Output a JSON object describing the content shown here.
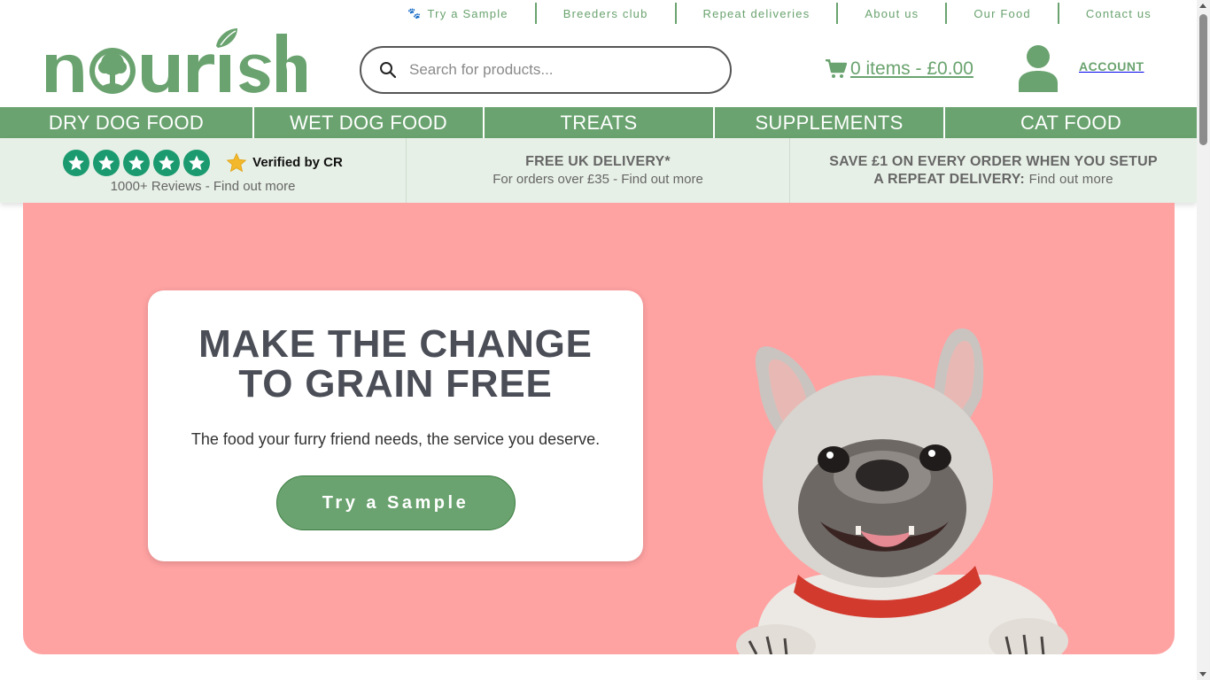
{
  "utility_nav": [
    {
      "label": "Try a Sample",
      "icon": "paw-icon"
    },
    {
      "label": "Breeders club"
    },
    {
      "label": "Repeat deliveries"
    },
    {
      "label": "About us"
    },
    {
      "label": "Our Food"
    },
    {
      "label": "Contact us"
    }
  ],
  "brand": {
    "logo_text": "nourish",
    "color": "#6aa36f"
  },
  "search": {
    "placeholder": "Search for products..."
  },
  "cart": {
    "summary": "0 items - £0.00"
  },
  "account": {
    "label": "ACCOUNT"
  },
  "categories": [
    {
      "label": "DRY DOG FOOD"
    },
    {
      "label": "WET DOG FOOD"
    },
    {
      "label": "TREATS"
    },
    {
      "label": "SUPPLEMENTS"
    },
    {
      "label": "CAT FOOD"
    }
  ],
  "usps": {
    "reviews": {
      "rating": 5,
      "verified": "Verified by CR",
      "sub": "1000+ Reviews - Find out more"
    },
    "delivery": {
      "title": "FREE UK DELIVERY*",
      "sub": "For orders over £35 - Find out more"
    },
    "repeat": {
      "title": "SAVE £1 ON EVERY ORDER WHEN YOU SETUP A REPEAT DELIVERY:",
      "link": "Find out more"
    }
  },
  "hero": {
    "title": "MAKE THE CHANGE TO GRAIN FREE",
    "subtitle": "The food your furry friend needs, the service you deserve.",
    "cta": "Try a Sample",
    "background": "#ffa2a2"
  }
}
